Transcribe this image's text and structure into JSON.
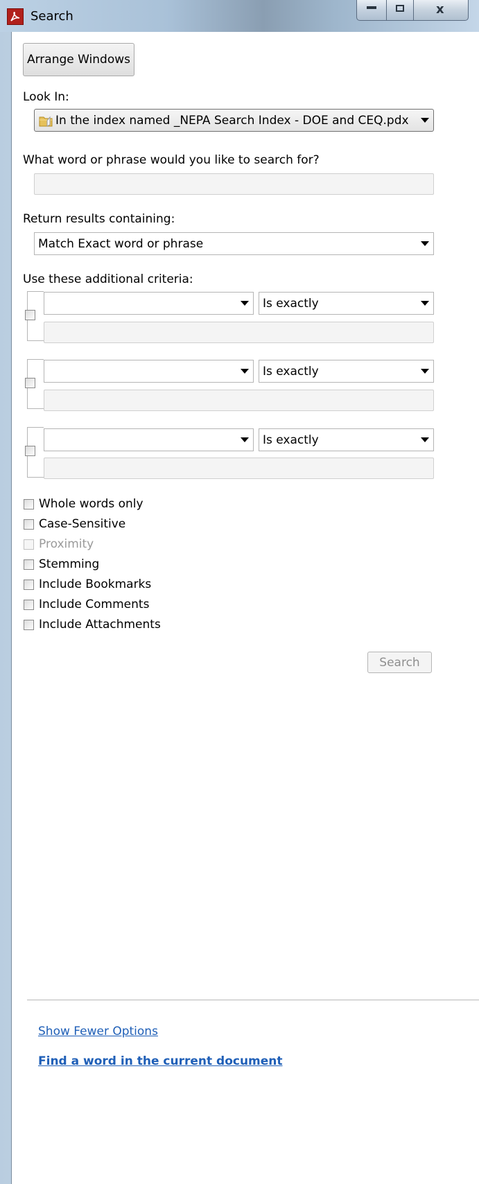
{
  "window": {
    "title": "Search",
    "controls": [
      "minimize",
      "maximize",
      "close"
    ]
  },
  "toolbar": {
    "arrange_windows": "Arrange Windows"
  },
  "look_in": {
    "label": "Look In:",
    "value": "In the index named _NEPA Search Index - DOE and CEQ.pdx",
    "icon": "folder-icon"
  },
  "search_for": {
    "label": "What word or phrase would you like to search for?",
    "value": ""
  },
  "return_results": {
    "label": "Return results containing:",
    "value": "Match Exact word or phrase"
  },
  "criteria": {
    "label": "Use these additional criteria:",
    "rows": [
      {
        "field": "",
        "operator": "Is exactly",
        "value": "",
        "checked": false
      },
      {
        "field": "",
        "operator": "Is exactly",
        "value": "",
        "checked": false
      },
      {
        "field": "",
        "operator": "Is exactly",
        "value": "",
        "checked": false
      }
    ]
  },
  "options": [
    {
      "label": "Whole words only",
      "checked": false,
      "enabled": true
    },
    {
      "label": "Case-Sensitive",
      "checked": false,
      "enabled": true
    },
    {
      "label": "Proximity",
      "checked": false,
      "enabled": false
    },
    {
      "label": "Stemming",
      "checked": false,
      "enabled": true
    },
    {
      "label": "Include Bookmarks",
      "checked": false,
      "enabled": true
    },
    {
      "label": "Include Comments",
      "checked": false,
      "enabled": true
    },
    {
      "label": "Include Attachments",
      "checked": false,
      "enabled": true
    }
  ],
  "search_button": "Search",
  "links": {
    "fewer_options": "Show Fewer Options",
    "find_in_document": "Find a word in the current document"
  }
}
